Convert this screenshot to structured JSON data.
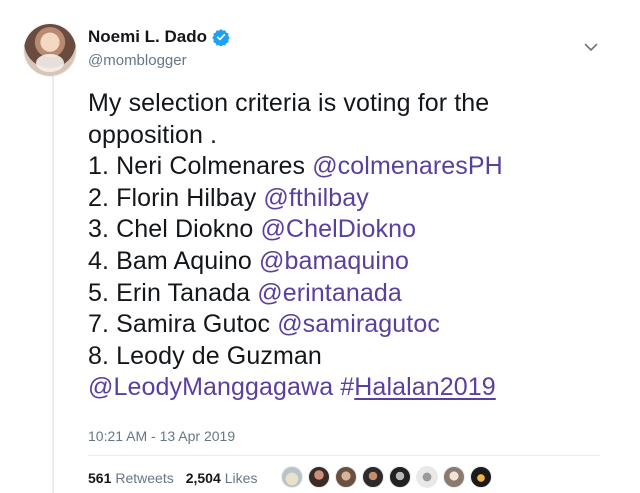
{
  "author": {
    "display_name": "Noemi L. Dado",
    "handle": "@momblogger",
    "verified_icon": "verified-badge-icon"
  },
  "tweet": {
    "lines": [
      {
        "text": "My selection criteria is voting for the"
      },
      {
        "text": "opposition ."
      },
      {
        "text": "1. Neri Colmenares ",
        "mention": "@colmenaresPH"
      },
      {
        "text": "2. Florin Hilbay ",
        "mention": "@fthilbay"
      },
      {
        "text": "3. Chel Diokno ",
        "mention": "@ChelDiokno"
      },
      {
        "text": "4. Bam Aquino ",
        "mention": "@bamaquino"
      },
      {
        "text": "5. Erin Tanada ",
        "mention": "@erintanada"
      },
      {
        "text": "7. Samira Gutoc ",
        "mention": "@samiragutoc"
      },
      {
        "text": "8. Leody de Guzman"
      }
    ],
    "last_line": {
      "mention": "@LeodyManggagawa",
      "hashtag_symbol": "#",
      "hashtag": "Halalan2019"
    },
    "timestamp": "10:21 AM - 13 Apr 2019"
  },
  "stats": {
    "retweets_count": "561",
    "retweets_label": "Retweets",
    "likes_count": "2,504",
    "likes_label": "Likes"
  },
  "colors": {
    "link": "#5b3f9e",
    "verified": "#1da1f2",
    "muted": "#657786"
  }
}
